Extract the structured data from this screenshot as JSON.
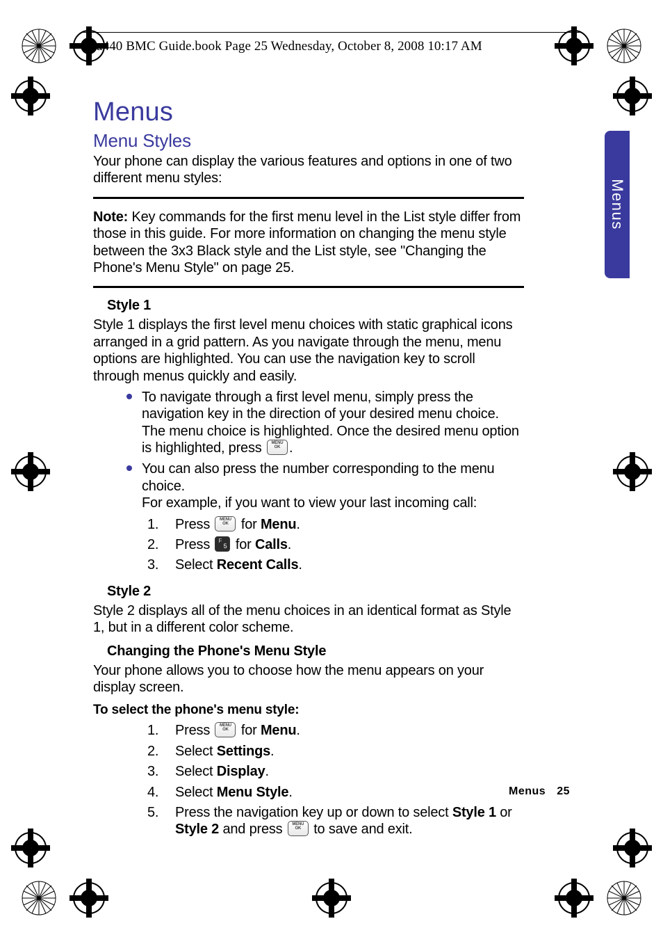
{
  "header": {
    "running_head": "u440 BMC Guide.book  Page 25  Wednesday, October 8, 2008  10:17 AM"
  },
  "side_tab": "Menus",
  "chapter_title": "Menus",
  "section_title": "Menu Styles",
  "intro": "Your phone can display the various features and options in one of two different menu styles:",
  "note": {
    "label": "Note:",
    "text": " Key commands for the first menu level in the List style differ from those in this guide. For more information on changing the menu style between the 3x3 Black style and the List style, see \"Changing the Phone's Menu Style\" on page 25."
  },
  "style1": {
    "heading": "Style 1",
    "para": "Style 1 displays the first level menu choices with static graphical icons arranged in a grid pattern. As you navigate through the menu, menu options are highlighted. You can use the navigation key to scroll through menus quickly and easily.",
    "bullet1_a": "To navigate through a first level menu, simply press the navigation key in the direction of your desired menu choice. The menu choice is highlighted. Once the desired menu option is highlighted, press ",
    "bullet1_b": ".",
    "bullet2_a": "You can also press the number corresponding to the menu choice.",
    "bullet2_b": "For example, if you want to view your last incoming call:",
    "steps": {
      "s1_a": "Press ",
      "s1_b": " for ",
      "s1_c": "Menu",
      "s1_d": ".",
      "s2_a": "Press ",
      "s2_b": " for ",
      "s2_c": "Calls",
      "s2_d": ".",
      "s3_a": "Select ",
      "s3_b": "Recent Calls",
      "s3_c": "."
    }
  },
  "style2": {
    "heading": "Style 2",
    "para": "Style 2 displays all of the menu choices in an identical format as Style 1, but in a different color scheme."
  },
  "changing": {
    "heading": "Changing the Phone's Menu Style",
    "para": "Your phone allows you to choose how the menu appears on your display screen.",
    "instr": "To select the phone's menu style:",
    "steps": {
      "s1_a": "Press ",
      "s1_b": " for ",
      "s1_c": "Menu",
      "s1_d": ".",
      "s2_a": "Select ",
      "s2_b": "Settings",
      "s2_c": ".",
      "s3_a": "Select ",
      "s3_b": "Display",
      "s3_c": ".",
      "s4_a": "Select ",
      "s4_b": "Menu Style",
      "s4_c": ".",
      "s5_a": "Press the navigation key up or down to select ",
      "s5_b": "Style 1",
      "s5_c": " or ",
      "s5_d": "Style 2",
      "s5_e": " and press ",
      "s5_f": " to save and exit."
    }
  },
  "footer": {
    "section": "Menus",
    "page": "25"
  },
  "nums": {
    "n1": "1.",
    "n2": "2.",
    "n3": "3.",
    "n4": "4.",
    "n5": "5."
  },
  "icons": {
    "menu_ok": "MENU\\AOK"
  }
}
